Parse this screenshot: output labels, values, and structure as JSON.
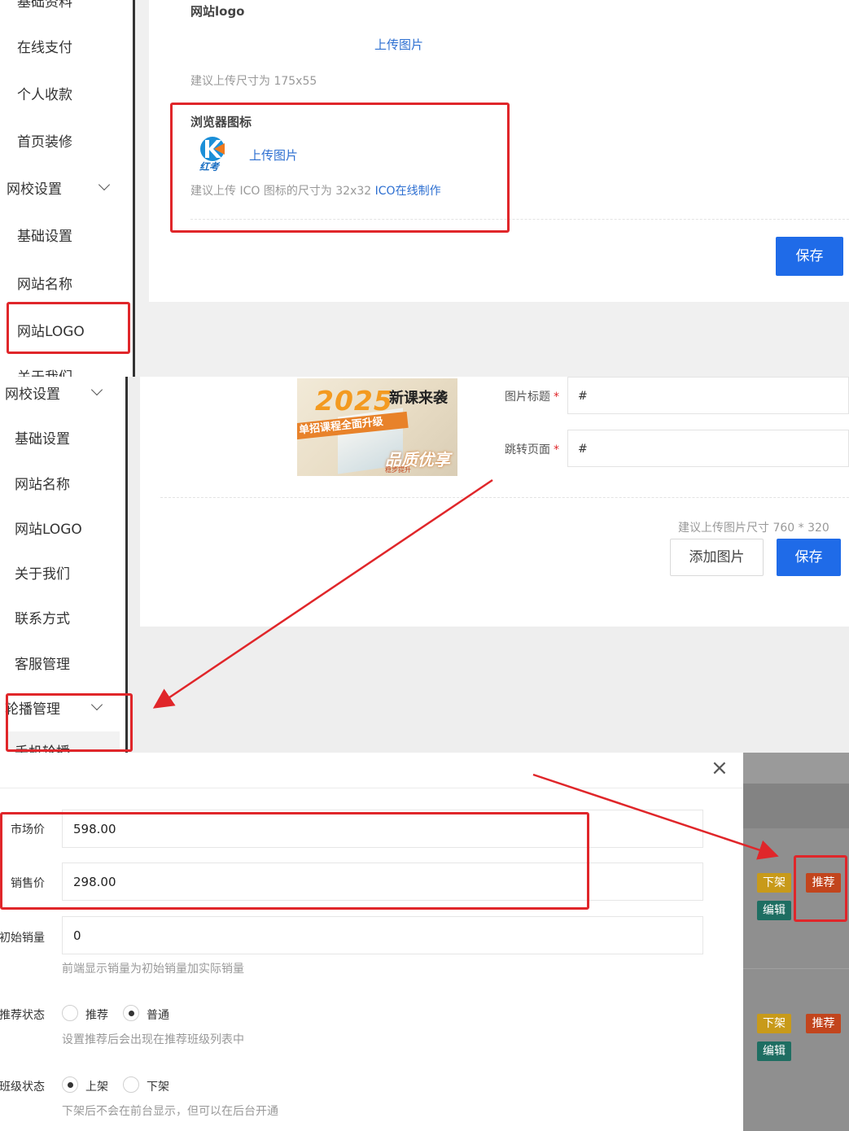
{
  "panel1": {
    "sidebar": {
      "partial_top": "基础资料",
      "items": [
        "在线支付",
        "个人收款",
        "首页装修"
      ],
      "group": "网校设置",
      "sub_items": [
        "基础设置",
        "网站名称",
        "网站LOGO"
      ],
      "partial_bottom": "关于我们"
    },
    "logo_section": {
      "label": "网站logo",
      "upload_link": "上传图片",
      "hint": "建议上传尺寸为 175x55"
    },
    "favicon_section": {
      "label": "浏览器图标",
      "upload_link": "上传图片",
      "hint": "建议上传 ICO 图标的尺寸为 32x32",
      "ico_link": "ICO在线制作",
      "logo_text": "红考"
    },
    "save_button": "保存"
  },
  "panel2": {
    "sidebar": {
      "group": "网校设置",
      "sub_items": [
        "基础设置",
        "网站名称",
        "网站LOGO",
        "关于我们",
        "联系方式",
        "客服管理"
      ],
      "carousel_group": "轮播管理",
      "partial_item": "手机轮播"
    },
    "banner": {
      "year": "2025",
      "headline": "新课来袭",
      "sub": "单招课程全面升级",
      "badge": "品质优享",
      "small": "稳步提升"
    },
    "form": {
      "title_label": "图片标题",
      "title_value": "#",
      "link_label": "跳转页面",
      "link_value": "#",
      "required_mark": "*"
    },
    "hint": "建议上传图片尺寸 760 * 320",
    "add_button": "添加图片",
    "save_button": "保存"
  },
  "panel3": {
    "close_icon": "×",
    "market_price": {
      "label": "市场价",
      "value": "598.00"
    },
    "sale_price": {
      "label": "销售价",
      "value": "298.00"
    },
    "initial_sales": {
      "label": "初始销量",
      "value": "0",
      "hint": "前端显示销量为初始销量加实际销量"
    },
    "recommend_status": {
      "label": "推荐状态",
      "options": [
        "推荐",
        "普通"
      ],
      "selected": "普通",
      "hint": "设置推荐后会出现在推荐班级列表中"
    },
    "class_status": {
      "label": "班级状态",
      "options": [
        "上架",
        "下架"
      ],
      "selected": "上架",
      "hint": "下架后不会在前台显示，但可以在后台开通"
    },
    "row_actions": [
      {
        "off": "下架",
        "recommend": "推荐",
        "edit": "编辑"
      },
      {
        "off": "下架",
        "recommend": "推荐",
        "edit": "编辑"
      }
    ]
  },
  "colors": {
    "primary": "#1f6be8",
    "link": "#2d6fd1",
    "annotation_red": "#e0262a",
    "tag_orange": "#c89a1a",
    "tag_red": "#c2451d",
    "tag_teal": "#1e6e62"
  }
}
